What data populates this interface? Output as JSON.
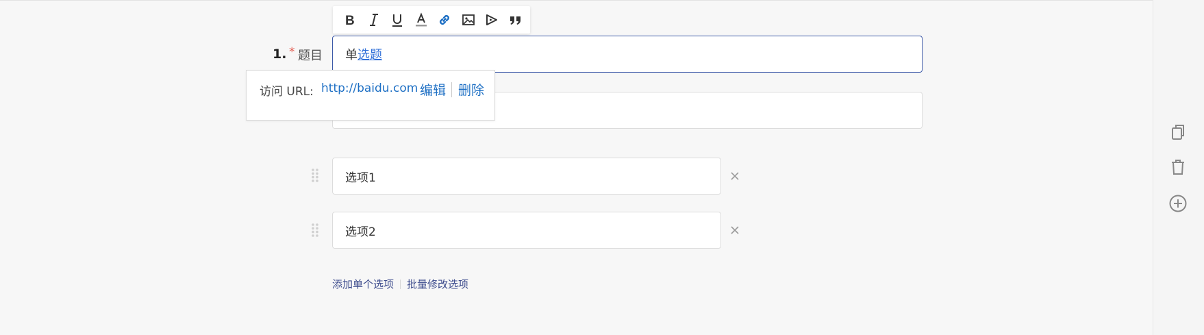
{
  "question": {
    "number": "1.",
    "required_mark": "*",
    "label": "题目",
    "title_plain": "单",
    "title_link": "选题"
  },
  "toolbar": {
    "buttons": [
      {
        "icon": "bold-icon"
      },
      {
        "icon": "italic-icon"
      },
      {
        "icon": "underline-icon"
      },
      {
        "icon": "font-color-icon"
      },
      {
        "icon": "link-icon",
        "active_color": "#1d6fc4"
      },
      {
        "icon": "image-icon"
      },
      {
        "icon": "video-icon"
      },
      {
        "icon": "quote-icon"
      }
    ]
  },
  "link_popup": {
    "label": "访问 URL:",
    "url": "http://baidu.com",
    "edit": "编辑",
    "delete": "删除"
  },
  "options": [
    {
      "label": "选项1"
    },
    {
      "label": "选项2"
    }
  ],
  "actions": {
    "add_single": "添加单个选项",
    "batch_edit": "批量修改选项"
  },
  "side_panel": {
    "icons": [
      "copy-icon",
      "trash-icon",
      "add-circle-icon"
    ]
  },
  "colors": {
    "accent_border": "#3d5aa8",
    "link": "#1d6fc4",
    "required": "#e2574c",
    "bottom_link": "#3b4a8c"
  }
}
